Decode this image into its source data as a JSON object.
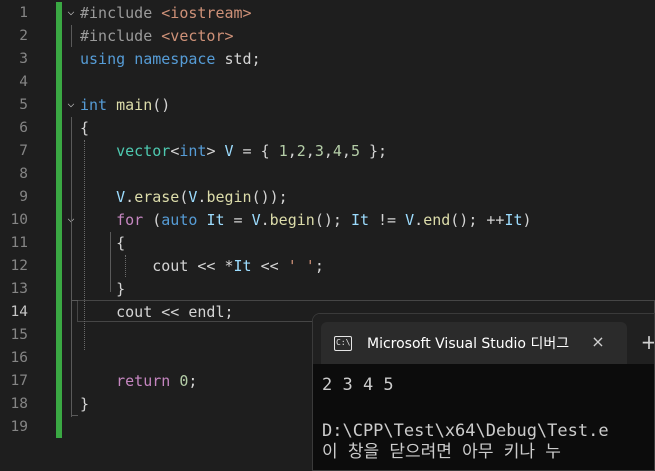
{
  "editor": {
    "line_numbers": [
      "1",
      "2",
      "3",
      "4",
      "5",
      "6",
      "7",
      "8",
      "9",
      "10",
      "11",
      "12",
      "13",
      "14",
      "15",
      "16",
      "17",
      "18",
      "19"
    ],
    "active_line": "14",
    "folds": [
      "⌵",
      "⌵",
      "⌵"
    ],
    "lines": [
      [
        {
          "c": "pp",
          "t": "#include "
        },
        {
          "c": "s",
          "t": "<iostream>"
        }
      ],
      [
        {
          "c": "pp",
          "t": "#include "
        },
        {
          "c": "s",
          "t": "<vector>"
        }
      ],
      [
        {
          "c": "k",
          "t": "using"
        },
        {
          "c": "p",
          "t": " "
        },
        {
          "c": "k",
          "t": "namespace"
        },
        {
          "c": "p",
          "t": " std;"
        }
      ],
      [],
      [
        {
          "c": "k",
          "t": "int"
        },
        {
          "c": "p",
          "t": " "
        },
        {
          "c": "f",
          "t": "main"
        },
        {
          "c": "p",
          "t": "()"
        }
      ],
      [
        {
          "c": "p",
          "t": "{"
        }
      ],
      [
        {
          "c": "p",
          "t": "    "
        },
        {
          "c": "t",
          "t": "vector"
        },
        {
          "c": "p",
          "t": "<"
        },
        {
          "c": "k",
          "t": "int"
        },
        {
          "c": "p",
          "t": "> "
        },
        {
          "c": "v",
          "t": "V"
        },
        {
          "c": "p",
          "t": " = { "
        },
        {
          "c": "n",
          "t": "1"
        },
        {
          "c": "p",
          "t": ","
        },
        {
          "c": "n",
          "t": "2"
        },
        {
          "c": "p",
          "t": ","
        },
        {
          "c": "n",
          "t": "3"
        },
        {
          "c": "p",
          "t": ","
        },
        {
          "c": "n",
          "t": "4"
        },
        {
          "c": "p",
          "t": ","
        },
        {
          "c": "n",
          "t": "5"
        },
        {
          "c": "p",
          "t": " };"
        }
      ],
      [],
      [
        {
          "c": "p",
          "t": "    "
        },
        {
          "c": "v",
          "t": "V"
        },
        {
          "c": "p",
          "t": "."
        },
        {
          "c": "f",
          "t": "erase"
        },
        {
          "c": "p",
          "t": "("
        },
        {
          "c": "v",
          "t": "V"
        },
        {
          "c": "p",
          "t": "."
        },
        {
          "c": "f",
          "t": "begin"
        },
        {
          "c": "p",
          "t": "());"
        }
      ],
      [
        {
          "c": "p",
          "t": "    "
        },
        {
          "c": "c",
          "t": "for"
        },
        {
          "c": "p",
          "t": " ("
        },
        {
          "c": "k",
          "t": "auto"
        },
        {
          "c": "p",
          "t": " "
        },
        {
          "c": "v",
          "t": "It"
        },
        {
          "c": "p",
          "t": " = "
        },
        {
          "c": "v",
          "t": "V"
        },
        {
          "c": "p",
          "t": "."
        },
        {
          "c": "f",
          "t": "begin"
        },
        {
          "c": "p",
          "t": "(); "
        },
        {
          "c": "v",
          "t": "It"
        },
        {
          "c": "p",
          "t": " != "
        },
        {
          "c": "v",
          "t": "V"
        },
        {
          "c": "p",
          "t": "."
        },
        {
          "c": "f",
          "t": "end"
        },
        {
          "c": "p",
          "t": "(); ++"
        },
        {
          "c": "v",
          "t": "It"
        },
        {
          "c": "p",
          "t": ")"
        }
      ],
      [
        {
          "c": "p",
          "t": "    {"
        }
      ],
      [
        {
          "c": "p",
          "t": "        cout << *"
        },
        {
          "c": "v",
          "t": "It"
        },
        {
          "c": "p",
          "t": " << "
        },
        {
          "c": "s",
          "t": "' '"
        },
        {
          "c": "p",
          "t": ";"
        }
      ],
      [
        {
          "c": "p",
          "t": "    }"
        }
      ],
      [
        {
          "c": "p",
          "t": "    cout << endl;"
        }
      ],
      [],
      [],
      [
        {
          "c": "p",
          "t": "    "
        },
        {
          "c": "c",
          "t": "return"
        },
        {
          "c": "p",
          "t": " "
        },
        {
          "c": "n",
          "t": "0"
        },
        {
          "c": "p",
          "t": ";"
        }
      ],
      [
        {
          "c": "p",
          "t": "}"
        }
      ],
      []
    ],
    "colors": {
      "background": "#1e1e1e",
      "change_bar": "#3aa843",
      "keyword": "#569cd6",
      "control": "#c586c0",
      "type": "#4ec9b0",
      "function": "#dcdcaa",
      "variable": "#9cdcfe",
      "number": "#b5cea8",
      "string": "#ce9178"
    }
  },
  "console": {
    "icon_label": "C:\\",
    "title": "Microsoft Visual Studio 디버그",
    "close_icon": "×",
    "new_tab_icon": "+",
    "output": [
      "2 3 4 5",
      "",
      "D:\\CPP\\Test\\x64\\Debug\\Test.e",
      "이 창을 닫으려면 아무 키나 누"
    ]
  }
}
